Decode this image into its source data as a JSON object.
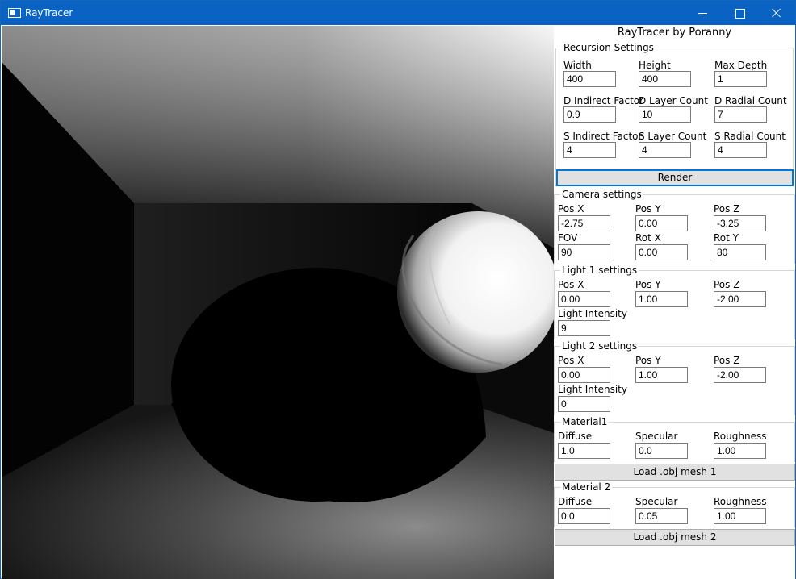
{
  "window": {
    "title": "RayTracer"
  },
  "panel": {
    "heading": "RayTracer by Poranny",
    "recursion": {
      "title": "Recursion Settings",
      "fields": [
        {
          "label": "Width",
          "value": "400"
        },
        {
          "label": "Height",
          "value": "400"
        },
        {
          "label": "Max Depth",
          "value": "1"
        },
        {
          "label": "D Indirect Factor",
          "value": "0.9"
        },
        {
          "label": "D Layer Count",
          "value": "10"
        },
        {
          "label": "D Radial Count",
          "value": "7"
        },
        {
          "label": "S Indirect Factor",
          "value": "4"
        },
        {
          "label": "S Layer Count",
          "value": "4"
        },
        {
          "label": "S Radial Count",
          "value": "4"
        }
      ]
    },
    "render_label": "Render",
    "camera": {
      "title": "Camera settings",
      "fields": [
        {
          "label": "Pos X",
          "value": "-2.75"
        },
        {
          "label": "Pos Y",
          "value": "0.00"
        },
        {
          "label": "Pos Z",
          "value": "-3.25"
        },
        {
          "label": "FOV",
          "value": "90"
        },
        {
          "label": "Rot X",
          "value": "0.00"
        },
        {
          "label": "Rot Y",
          "value": "80"
        }
      ]
    },
    "light1": {
      "title": "Light 1 settings",
      "fields": [
        {
          "label": "Pos X",
          "value": "0.00"
        },
        {
          "label": "Pos Y",
          "value": "1.00"
        },
        {
          "label": "Pos Z",
          "value": "-2.00"
        },
        {
          "label": "Light Intensity",
          "value": "9"
        }
      ]
    },
    "light2": {
      "title": "Light 2 settings",
      "fields": [
        {
          "label": "Pos X",
          "value": "0.00"
        },
        {
          "label": "Pos Y",
          "value": "1.00"
        },
        {
          "label": "Pos Z",
          "value": "-2.00"
        },
        {
          "label": "Light Intensity",
          "value": "0"
        }
      ]
    },
    "material1": {
      "title": "Material1",
      "fields": [
        {
          "label": "Diffuse",
          "value": "1.0"
        },
        {
          "label": "Specular",
          "value": "0.0"
        },
        {
          "label": "Roughness",
          "value": "1.00"
        }
      ],
      "load_label": "Load .obj mesh 1"
    },
    "material2": {
      "title": "Material 2",
      "fields": [
        {
          "label": "Diffuse",
          "value": "0.0"
        },
        {
          "label": "Specular",
          "value": "0.05"
        },
        {
          "label": "Roughness",
          "value": "1.00"
        }
      ],
      "load_label": "Load .obj mesh 2"
    }
  }
}
